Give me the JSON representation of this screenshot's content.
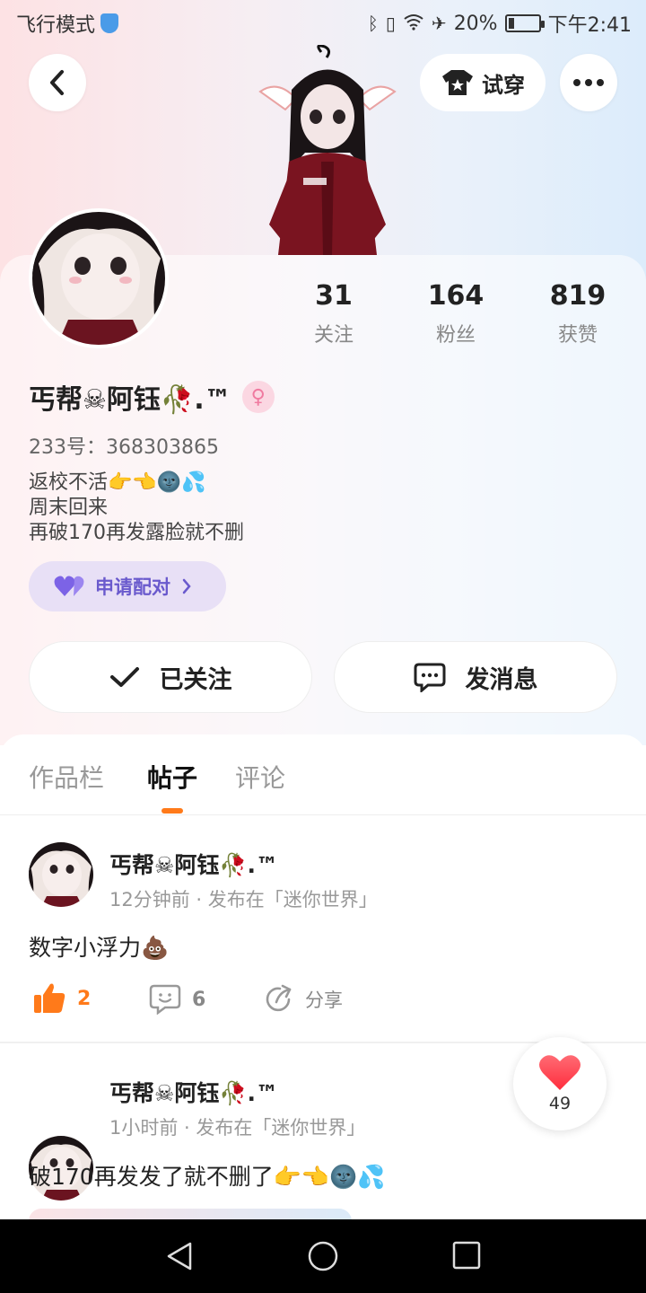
{
  "status_bar": {
    "left_text": "飞行模式",
    "battery": "20%",
    "battery_level": 0.2,
    "time": "下午2:41"
  },
  "header": {
    "try_on_label": "试穿"
  },
  "profile": {
    "name": "丐帮☠阿钰🥀.™",
    "gender_symbol": "♀",
    "id_line": "233号：368303865",
    "bio": [
      "返校不活👉👈🌚💦",
      "周末回来",
      "再破170再发露脸就不删"
    ],
    "match_label": "申请配对",
    "stats": [
      {
        "value": "31",
        "label": "关注"
      },
      {
        "value": "164",
        "label": "粉丝"
      },
      {
        "value": "819",
        "label": "获赞"
      }
    ],
    "followed_label": "已关注",
    "message_label": "发消息"
  },
  "tabs": [
    {
      "label": "作品栏",
      "active": false
    },
    {
      "label": "帖子",
      "active": true
    },
    {
      "label": "评论",
      "active": false
    }
  ],
  "posts": [
    {
      "author": "丐帮☠阿钰🥀.™",
      "meta": "12分钟前 · 发布在「迷你世界」",
      "text": "数字小浮力💩",
      "likes": "2",
      "comments": "6",
      "share_label": "分享"
    },
    {
      "author": "丐帮☠阿钰🥀.™",
      "meta": "1小时前 · 发布在「迷你世界」",
      "text": "破170再发发了就不删了👉👈🌚💦"
    }
  ],
  "floating_like": {
    "count": "49"
  },
  "colors": {
    "accent_orange": "#ff7a1a",
    "match_purple": "#6a5acd",
    "heart_red": "#ff3b4a"
  }
}
